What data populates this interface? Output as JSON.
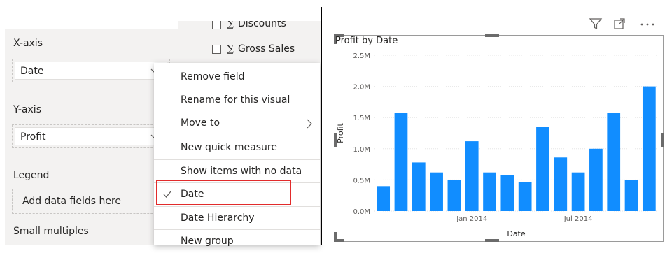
{
  "field_wells": {
    "xaxis_label": "X-axis",
    "xaxis_value": "Date",
    "yaxis_label": "Y-axis",
    "yaxis_value": "Profit",
    "legend_label": "Legend",
    "legend_placeholder": "Add data fields here",
    "small_multiples_label": "Small multiples"
  },
  "fields_list": {
    "items": [
      {
        "label": "Discounts"
      },
      {
        "label": "Gross Sales"
      }
    ]
  },
  "context_menu": {
    "items": [
      {
        "label": "Remove field"
      },
      {
        "label": "Rename for this visual"
      },
      {
        "label": "Move to"
      },
      {
        "label": "New quick measure"
      },
      {
        "label": "Show items with no data"
      },
      {
        "label": "Date",
        "checked": true
      },
      {
        "label": "Date Hierarchy"
      },
      {
        "label": "New group"
      }
    ],
    "highlight_color": "#e22b2b"
  },
  "visual_header": {
    "icons": [
      "filter-icon",
      "focus-mode-icon",
      "more-options-icon"
    ]
  },
  "chart_data": {
    "type": "bar",
    "title": "Profit by Date",
    "xlabel": "Date",
    "ylabel": "Profit",
    "y_ticks": [
      "0.0M",
      "0.5M",
      "1.0M",
      "1.5M",
      "2.0M",
      "2.5M"
    ],
    "ylim": [
      0,
      2.5
    ],
    "x_tick_labels": [
      {
        "label": "Jan 2014",
        "index": 5
      },
      {
        "label": "Jul 2014",
        "index": 11
      }
    ],
    "values": [
      0.4,
      1.58,
      0.78,
      0.62,
      0.5,
      1.12,
      0.62,
      0.58,
      0.46,
      1.35,
      0.86,
      0.62,
      1.0,
      1.58,
      0.5,
      2.0
    ],
    "bar_color": "#118dff",
    "grid": true
  }
}
